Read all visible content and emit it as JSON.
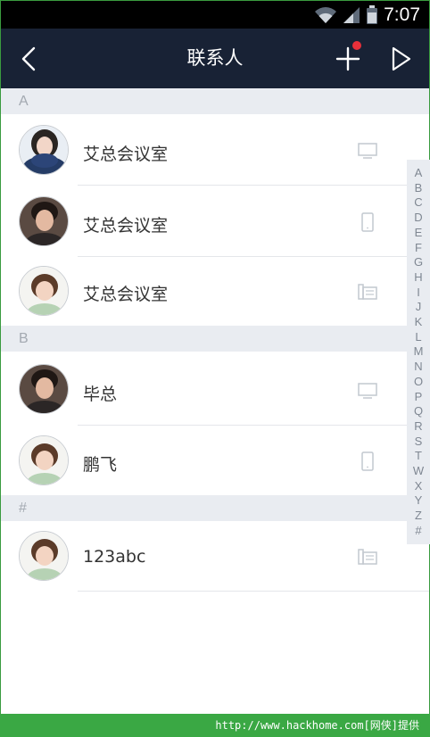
{
  "status_bar": {
    "time": "7:07"
  },
  "header": {
    "title": "联系人"
  },
  "sections": [
    {
      "letter": "A",
      "contacts": [
        {
          "name": "艾总会议室",
          "device": "desktop-icon"
        },
        {
          "name": "艾总会议室",
          "device": "phone-icon"
        },
        {
          "name": "艾总会议室",
          "device": "landline-icon"
        }
      ]
    },
    {
      "letter": "B",
      "contacts": [
        {
          "name": "毕总",
          "device": "desktop-icon"
        },
        {
          "name": "鹏飞",
          "device": "phone-icon"
        }
      ]
    },
    {
      "letter": "#",
      "contacts": [
        {
          "name": "123abc",
          "device": "landline-icon"
        }
      ]
    }
  ],
  "index": [
    "A",
    "B",
    "C",
    "D",
    "E",
    "F",
    "G",
    "H",
    "I",
    "J",
    "K",
    "L",
    "M",
    "N",
    "O",
    "P",
    "Q",
    "R",
    "S",
    "T",
    "W",
    "X",
    "Y",
    "Z",
    "#"
  ],
  "watermark": "http://www.hackhome.com[网侠]提供",
  "colors": {
    "nav_bg": "#182235",
    "accent_red": "#e8303a",
    "section_bg": "#e9ecf1",
    "watermark_bg": "#3aa844"
  }
}
